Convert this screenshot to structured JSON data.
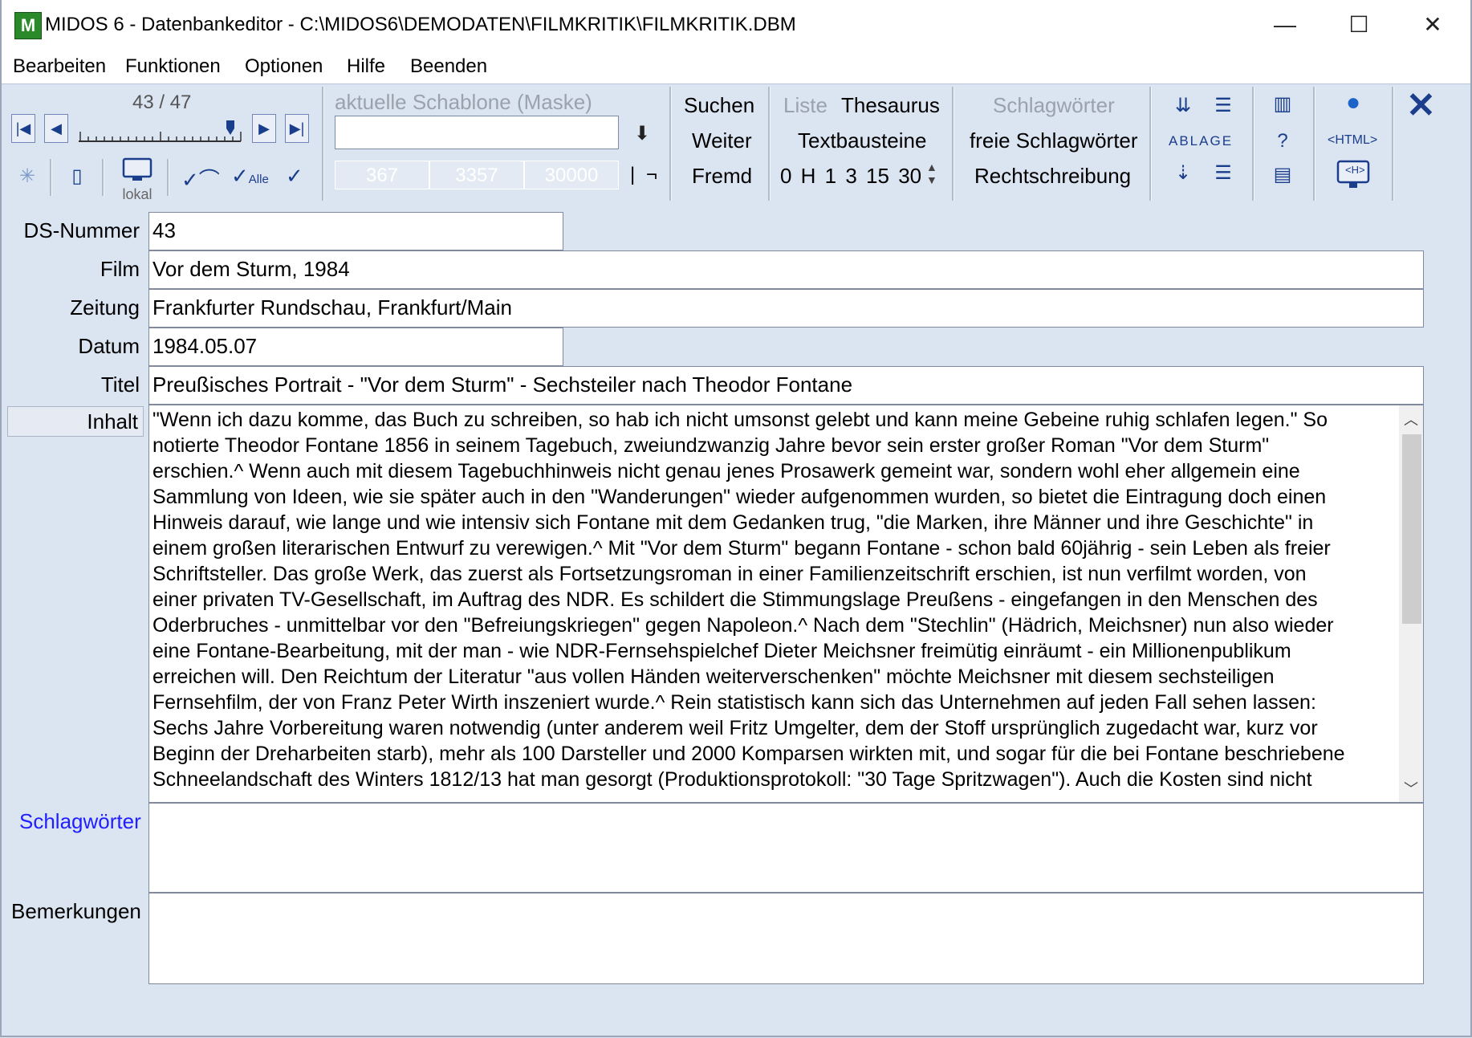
{
  "window": {
    "title": "MIDOS 6 - Datenbankeditor - C:\\MIDOS6\\DEMODATEN\\FILMKRITIK\\FILMKRITIK.DBM",
    "app_icon_letter": "M",
    "minimize_glyph": "—",
    "maximize_glyph": "☐",
    "close_glyph": "✕"
  },
  "menu": {
    "items": [
      "Bearbeiten",
      "Funktionen",
      "Optionen",
      "Hilfe",
      "Beenden"
    ]
  },
  "toolbar": {
    "record_counter": "43 / 47",
    "local_label": "lokal",
    "template_label": "aktuelle Schablone (Maske)",
    "template_value": "",
    "template_numbers": [
      "367",
      "3357",
      "30000"
    ],
    "template_side_glyphs": [
      "|",
      "¬"
    ],
    "search": [
      "Suchen",
      "Weiter",
      "Fremd"
    ],
    "lists": {
      "liste": "Liste",
      "thesaurus": "Thesaurus",
      "textbausteine": "Textbausteine",
      "levels": "0 H 1 3 15 30"
    },
    "keywords": [
      "Schlagwörter",
      "freie Schlagwörter",
      "Rechtschreibung"
    ],
    "ablage_label": "ABLAGE",
    "help_glyph": "?",
    "html_label": "<HTML>",
    "html_sub": "<H>",
    "close_glyph": "✕",
    "accent_color": "#1a3e8c"
  },
  "form": {
    "ds_nummer": {
      "label": "DS-Nummer",
      "value": "43"
    },
    "film": {
      "label": "Film",
      "value": "Vor dem Sturm, 1984"
    },
    "zeitung": {
      "label": "Zeitung",
      "value": "Frankfurter Rundschau, Frankfurt/Main"
    },
    "datum": {
      "label": "Datum",
      "value": "1984.05.07"
    },
    "titel": {
      "label": "Titel",
      "value": "Preußisches Portrait - \"Vor dem Sturm\" - Sechsteiler nach Theodor Fontane"
    },
    "inhalt": {
      "label": "Inhalt",
      "lines": [
        "\"Wenn ich dazu komme, das Buch zu schreiben, so hab ich nicht umsonst gelebt und kann meine Gebeine ruhig schlafen legen.\" So",
        "notierte Theodor Fontane 1856 in seinem Tagebuch, zweiundzwanzig Jahre bevor sein erster großer Roman \"Vor dem Sturm\"",
        "erschien.^ Wenn auch mit diesem Tagebuchhinweis nicht genau jenes Prosawerk gemeint war, sondern wohl eher allgemein eine",
        "Sammlung von Ideen, wie sie später auch in den \"Wanderungen\" wieder aufgenommen wurden, so bietet die Eintragung doch einen",
        "Hinweis darauf, wie lange und wie intensiv sich Fontane mit dem Gedanken trug, \"die Marken, ihre Männer und ihre Geschichte\" in",
        "einem großen literarischen Entwurf zu verewigen.^ Mit \"Vor dem Sturm\" begann Fontane - schon bald 60jährig - sein Leben als freier",
        "Schriftsteller. Das große Werk, das zuerst als Fortsetzungsroman in einer Familienzeitschrift erschien, ist nun verfilmt worden, von",
        "einer privaten TV-Gesellschaft, im Auftrag des NDR. Es schildert die Stimmungslage Preußens - eingefangen in den Menschen des",
        "Oderbruches - unmittelbar vor den \"Befreiungskriegen\" gegen Napoleon.^ Nach dem \"Stechlin\" (Hädrich, Meichsner) nun also wieder",
        "eine Fontane-Bearbeitung, mit der man - wie NDR-Fernsehspielchef Dieter Meichsner freimütig einräumt - ein Millionenpublikum",
        "erreichen will. Den Reichtum der Literatur \"aus vollen Händen weiterverschenken\" möchte Meichsner mit diesem sechsteiligen",
        "Fernsehfilm, der von Franz Peter Wirth inszeniert wurde.^ Rein statistisch kann sich das Unternehmen auf jeden Fall sehen lassen:",
        "Sechs Jahre Vorbereitung waren notwendig (unter anderem weil Fritz Umgelter, dem der Stoff ursprünglich zugedacht war, kurz vor",
        "Beginn der Dreharbeiten starb), mehr als 100 Darsteller und 2000 Komparsen wirkten mit, und sogar für die bei Fontane beschriebene",
        "Schneelandschaft des Winters 1812/13 hat man gesorgt (Produktionsprotokoll: \"30 Tage Spritzwagen\"). Auch die Kosten sind nicht"
      ]
    },
    "schlagwoerter": {
      "label": "Schlagwörter",
      "value": "",
      "label_color": "#1f1fff"
    },
    "bemerkungen": {
      "label": "Bemerkungen",
      "value": ""
    }
  }
}
